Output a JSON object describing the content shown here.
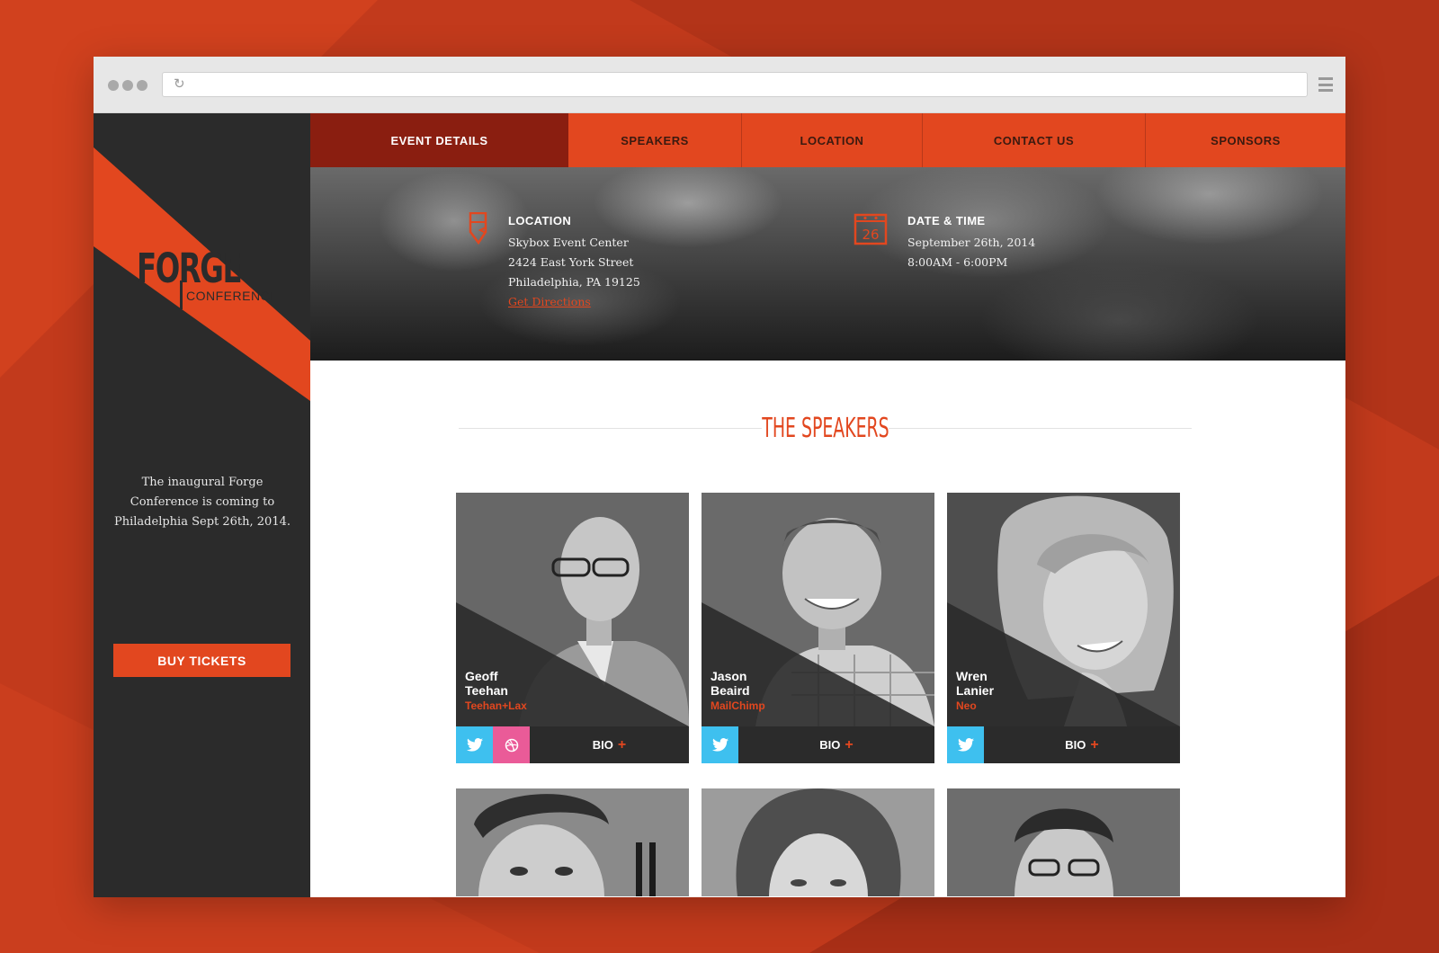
{
  "colors": {
    "accent": "#e2471f",
    "dark": "#2b2b2b",
    "nav_active": "#8a1e10",
    "twitter": "#3ec0ef",
    "dribbble": "#ea5b98"
  },
  "browser": {
    "reload_icon": "reload-icon",
    "menu_icon": "hamburger-menu-icon"
  },
  "sidebar": {
    "logo_main": "FORGE",
    "logo_sub": "CONFERENCE",
    "tagline": "The inaugural Forge Conference is coming to Philadelphia Sept 26th, 2014.",
    "buy_button": "BUY TICKETS"
  },
  "nav": {
    "items": [
      {
        "label": "EVENT DETAILS",
        "active": true
      },
      {
        "label": "SPEAKERS",
        "active": false
      },
      {
        "label": "LOCATION",
        "active": false
      },
      {
        "label": "CONTACT US",
        "active": false
      },
      {
        "label": "SPONSORS",
        "active": false
      }
    ]
  },
  "event": {
    "location": {
      "title": "LOCATION",
      "lines": [
        "Skybox Event Center",
        "2424 East York Street",
        "Philadelphia, PA 19125"
      ],
      "link": "Get Directions",
      "icon": "map-pin-icon"
    },
    "datetime": {
      "title": "DATE & TIME",
      "lines": [
        "September 26th, 2014",
        "8:00AM - 6:00PM"
      ],
      "icon": "calendar-icon",
      "icon_day": "26"
    }
  },
  "speakers": {
    "title": "THE SPEAKERS",
    "bio_label": "BIO",
    "cards": [
      {
        "first": "Geoff",
        "last": "Teehan",
        "company": "Teehan+Lax",
        "social": [
          "twitter",
          "dribbble"
        ]
      },
      {
        "first": "Jason",
        "last": "Beaird",
        "company": "MailChimp",
        "social": [
          "twitter"
        ]
      },
      {
        "first": "Wren",
        "last": "Lanier",
        "company": "Neo",
        "social": [
          "twitter"
        ]
      }
    ]
  }
}
